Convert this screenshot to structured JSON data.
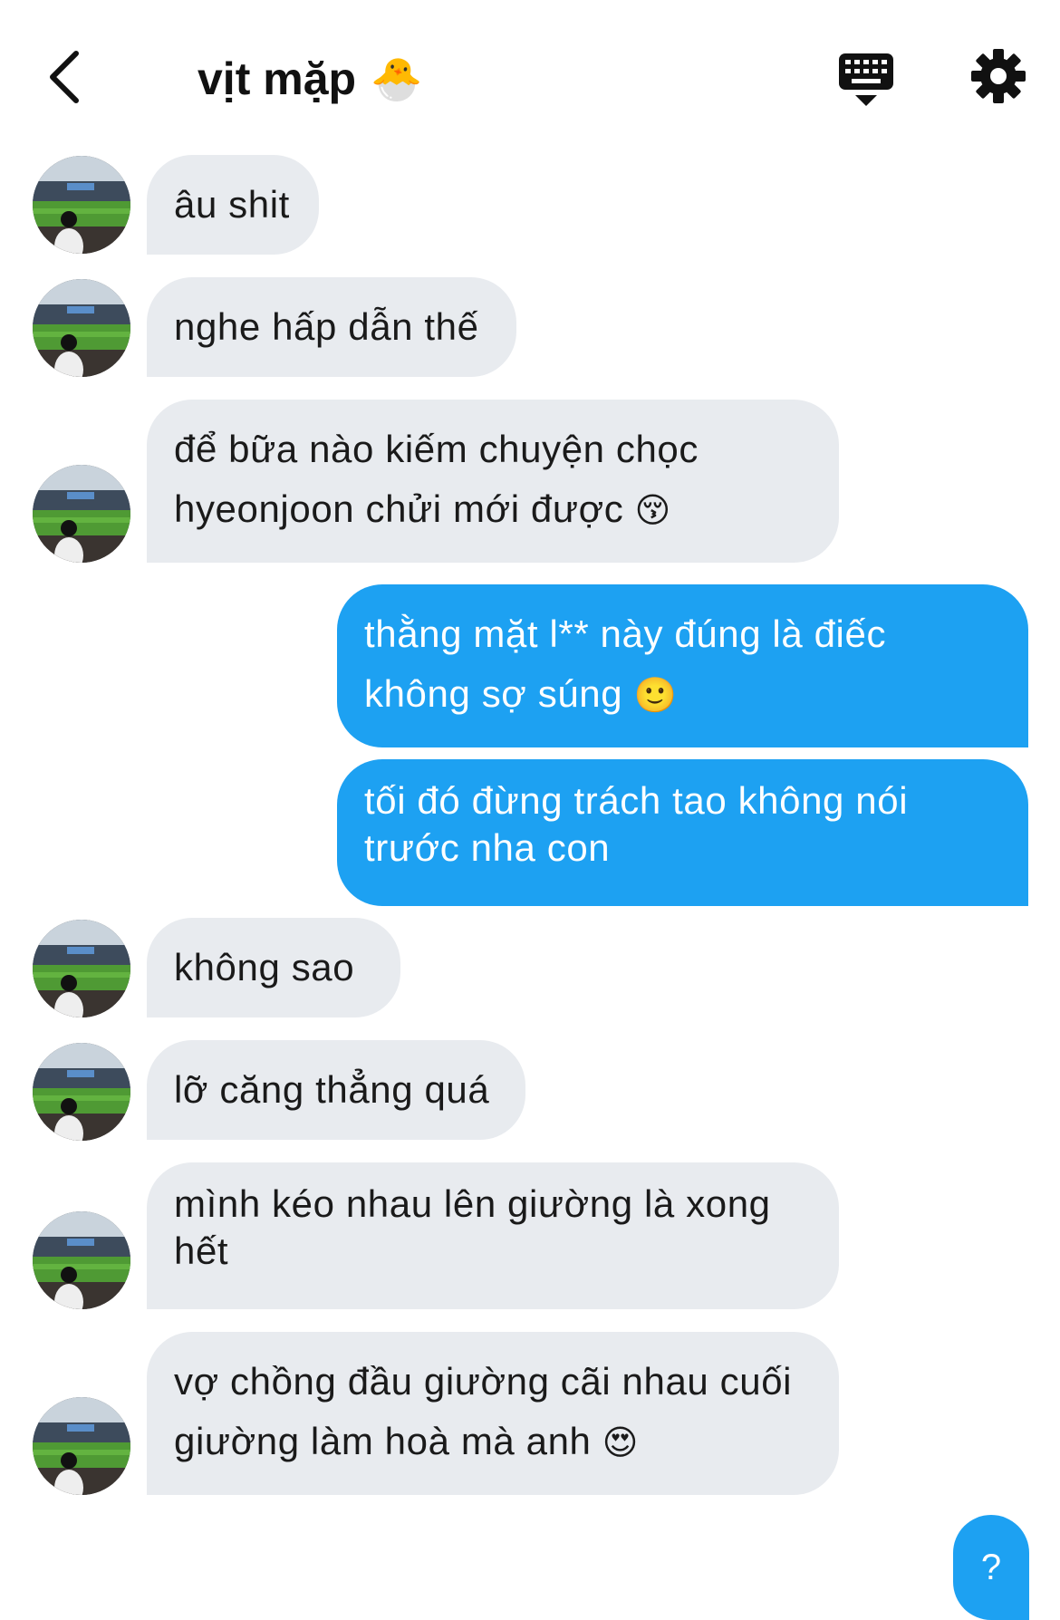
{
  "header": {
    "title": "vịt mặp",
    "title_emoji": "🐣",
    "back_icon": "chevron-left-icon",
    "keyboard_icon": "keyboard-icon",
    "settings_icon": "gear-icon"
  },
  "messages": [
    {
      "from": "them",
      "lines": [
        "âu shit"
      ]
    },
    {
      "from": "them",
      "lines": [
        "nghe hấp dẫn thế"
      ]
    },
    {
      "from": "them",
      "lines": [
        "để bữa nào kiếm chuyện chọc",
        "hyeonjoon chửi mới được"
      ],
      "emoji": "😚"
    },
    {
      "from": "me",
      "lines": [
        "thằng mặt l** này đúng là điếc",
        "không sợ súng"
      ],
      "emoji": "🙂"
    },
    {
      "from": "me",
      "lines": [
        "tối đó đừng trách tao không nói",
        "trước nha con"
      ]
    },
    {
      "from": "them",
      "lines": [
        "không sao"
      ]
    },
    {
      "from": "them",
      "lines": [
        "lỡ căng thẳng quá"
      ]
    },
    {
      "from": "them",
      "lines": [
        "mình kéo nhau lên giường là xong",
        "hết"
      ]
    },
    {
      "from": "them",
      "lines": [
        "vợ chồng đầu giường cãi nhau cuối",
        "giường làm hoà mà anh"
      ],
      "emoji": "😍"
    }
  ],
  "help_button": {
    "label": "?"
  },
  "colors": {
    "incoming_bubble": "#e8ebef",
    "outgoing_bubble": "#1da1f2",
    "accent": "#1da1f2"
  }
}
